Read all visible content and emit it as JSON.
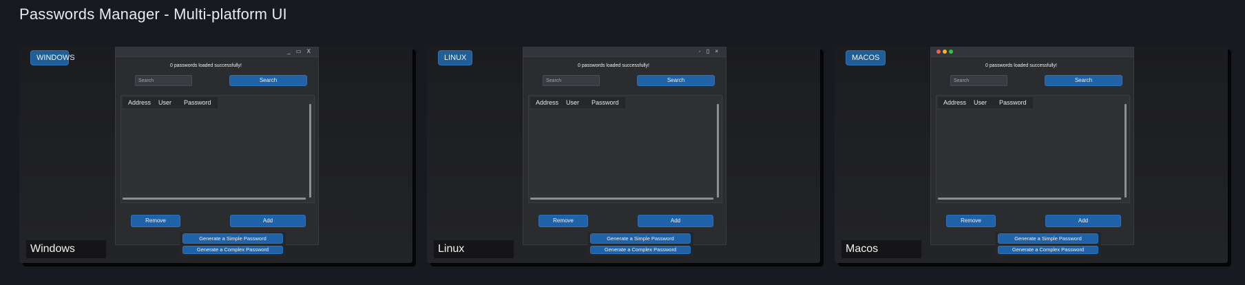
{
  "page": {
    "title": "Passwords Manager - Multi-platform UI"
  },
  "panels": [
    {
      "badge": "WINDOWS",
      "caption": "Windows",
      "window_controls": "_ ▭ X",
      "status": "0 passwords loaded successfully!",
      "search_placeholder": "Search",
      "search_label": "Search",
      "columns": [
        "Address",
        "User",
        "Password"
      ],
      "remove_label": "Remove",
      "add_label": "Add",
      "gen_simple_label": "Generate a Simple Password",
      "gen_complex_label": "Generate a Complex Password"
    },
    {
      "badge": "LINUX",
      "caption": "Linux",
      "window_controls": "- ▯ ×",
      "status": "0 passwords loaded successfully!",
      "search_placeholder": "Search",
      "search_label": "Search",
      "columns": [
        "Address",
        "User",
        "Password"
      ],
      "remove_label": "Remove",
      "add_label": "Add",
      "gen_simple_label": "Generate a Simple Password",
      "gen_complex_label": "Generate a Complex Password"
    },
    {
      "badge": "MACOS",
      "caption": "Macos",
      "traffic_lights": [
        "#ee5f57",
        "#f3bb2b",
        "#2ec742"
      ],
      "status": "0 passwords loaded successfully!",
      "search_placeholder": "Search",
      "search_label": "Search",
      "columns": [
        "Address",
        "User",
        "Password"
      ],
      "remove_label": "Remove",
      "add_label": "Add",
      "gen_simple_label": "Generate a Simple Password",
      "gen_complex_label": "Generate a Complex Password"
    }
  ],
  "colors": {
    "accent": "#1f62a8",
    "background": "#171a21"
  }
}
